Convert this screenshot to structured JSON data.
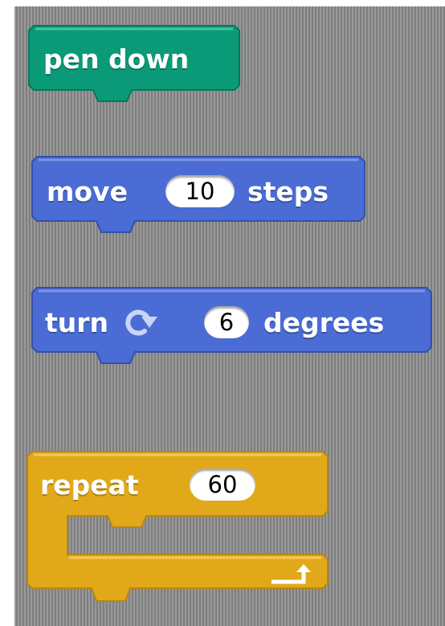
{
  "colors": {
    "pen": "#0a9a77",
    "motion": "#4a6cd4",
    "control": "#e1a91a"
  },
  "blocks": {
    "pen_down": {
      "label": "pen down"
    },
    "move": {
      "before": "move",
      "value": "10",
      "after": "steps"
    },
    "turn": {
      "before": "turn",
      "icon": "rotate-clockwise-icon",
      "value": "6",
      "after": "degrees"
    },
    "repeat": {
      "before": "repeat",
      "value": "60",
      "icon": "loop-arrow-icon"
    }
  }
}
